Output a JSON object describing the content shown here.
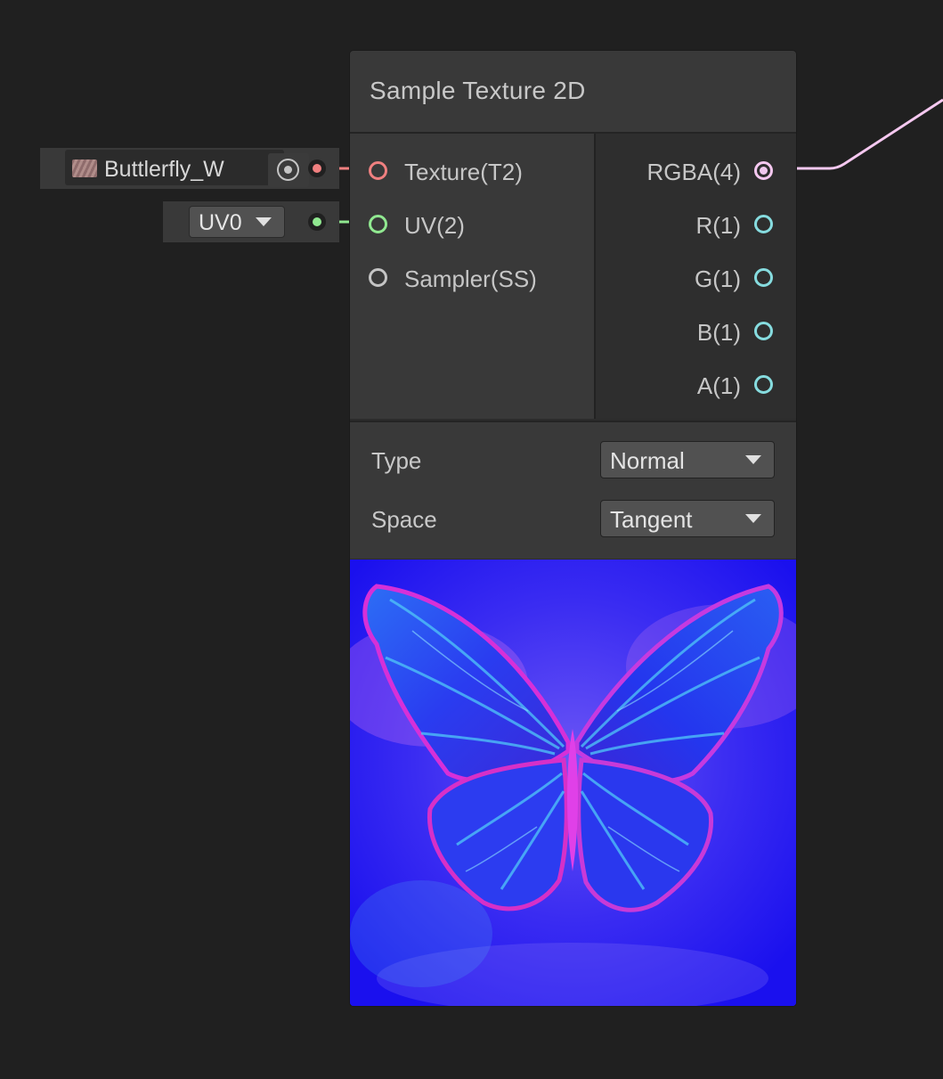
{
  "node": {
    "title": "Sample Texture 2D",
    "inputs": [
      {
        "label": "Texture(T2)",
        "color": "#f08080"
      },
      {
        "label": "UV(2)",
        "color": "#90e890"
      },
      {
        "label": "Sampler(SS)",
        "color": "#c4c4c4"
      }
    ],
    "outputs": [
      {
        "label": "RGBA(4)",
        "color": "#f5c8f0"
      },
      {
        "label": "R(1)",
        "color": "#86dcdf"
      },
      {
        "label": "G(1)",
        "color": "#86dcdf"
      },
      {
        "label": "B(1)",
        "color": "#86dcdf"
      },
      {
        "label": "A(1)",
        "color": "#86dcdf"
      }
    ],
    "settings": {
      "type_label": "Type",
      "type_value": "Normal",
      "space_label": "Space",
      "space_value": "Tangent"
    },
    "preview": {
      "icon": "butterfly-normal-map-preview"
    }
  },
  "inline_fields": {
    "texture_name": "Buttlerfly_W",
    "uv_value": "UV0"
  },
  "colors": {
    "background": "#202020",
    "texture_wire": "#f08080",
    "uv_wire": "#90e890",
    "rgba_wire": "#f5c8f0",
    "vector1_port": "#86dcdf"
  }
}
